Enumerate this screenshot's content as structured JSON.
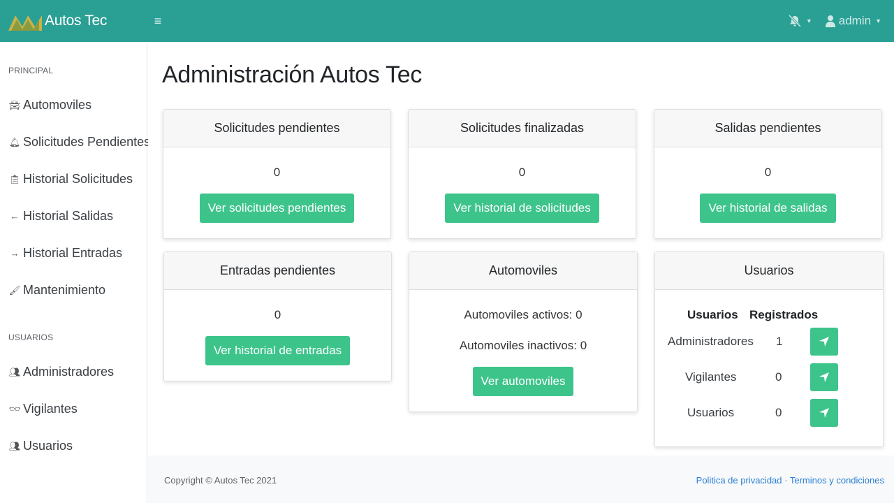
{
  "header": {
    "brand_name": "Autos Tec",
    "toggle_icon": "hamburger-icon",
    "user_label": "admin",
    "colors": {
      "topbar": "#2a9f94",
      "accent_button": "#3dc48b"
    }
  },
  "sidebar": {
    "principal_heading": "PRINCIPAL",
    "usuarios_heading": "USUARIOS",
    "items": [
      {
        "label": "Automoviles",
        "icon": "car-icon"
      },
      {
        "label": "Solicitudes Pendientes",
        "icon": "bell-icon"
      },
      {
        "label": "Historial Solicitudes",
        "icon": "clipboard-icon"
      },
      {
        "label": "Historial Salidas",
        "icon": "arrow-left-icon"
      },
      {
        "label": "Historial Entradas",
        "icon": "arrow-right-icon"
      },
      {
        "label": "Mantenimiento",
        "icon": "brush-icon"
      },
      {
        "label": "Administradores",
        "icon": "users-cog-icon"
      },
      {
        "label": "Vigilantes",
        "icon": "glasses-icon"
      },
      {
        "label": "Usuarios",
        "icon": "users-icon"
      }
    ]
  },
  "main": {
    "title": "Administración Autos Tec",
    "cards": {
      "solicitudes_pendientes": {
        "title": "Solicitudes pendientes",
        "count": "0",
        "button": "Ver solicitudes pendientes"
      },
      "solicitudes_finalizadas": {
        "title": "Solicitudes finalizadas",
        "count": "0",
        "button": "Ver historial de solicitudes"
      },
      "salidas_pendientes": {
        "title": "Salidas pendientes",
        "count": "0",
        "button": "Ver historial de salidas"
      },
      "entradas_pendientes": {
        "title": "Entradas pendientes",
        "count": "0",
        "button": "Ver historial de entradas"
      },
      "automoviles": {
        "title": "Automoviles",
        "activos": "Automoviles activos: 0",
        "inactivos": "Automoviles inactivos: 0",
        "button": "Ver automoviles"
      },
      "usuarios": {
        "title": "Usuarios",
        "col_usuarios": "Usuarios",
        "col_registrados": "Registrados",
        "rows": [
          {
            "name": "Administradores",
            "count": "1"
          },
          {
            "name": "Vigilantes",
            "count": "0"
          },
          {
            "name": "Usuarios",
            "count": "0"
          }
        ]
      }
    }
  },
  "footer": {
    "copyright": "Copyright © Autos Tec 2021",
    "privacy_link": "Politica de privacidad",
    "separator": "·",
    "terms_link": "Terminos y condiciones"
  }
}
